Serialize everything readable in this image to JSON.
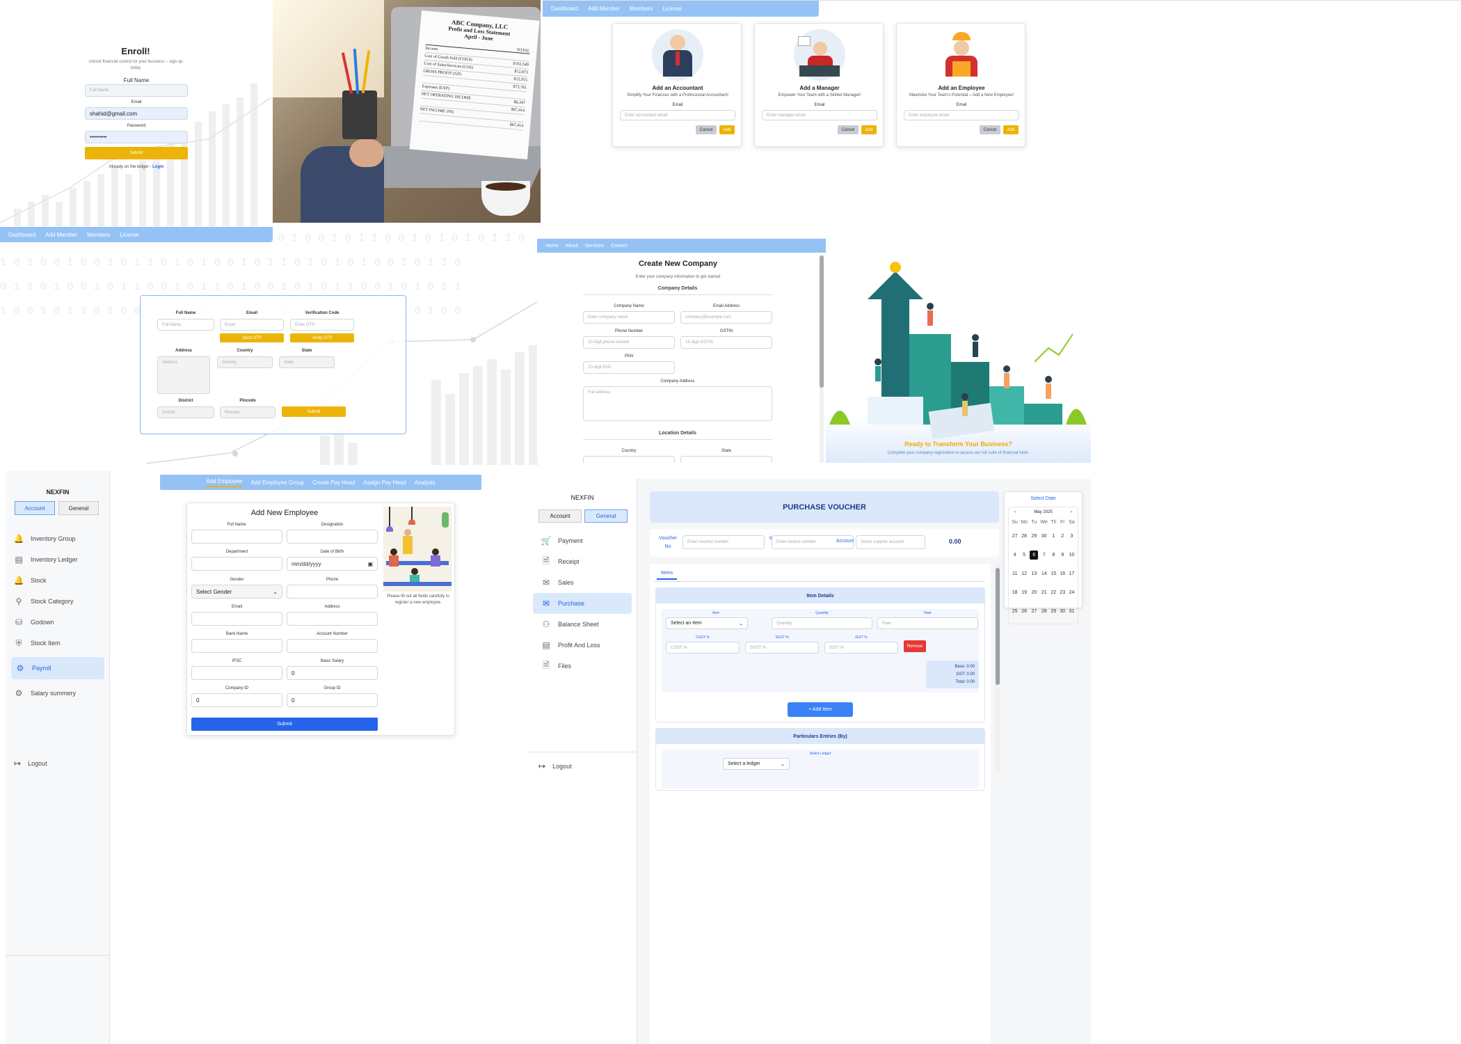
{
  "enroll": {
    "title": "Enroll!",
    "subtitle": "Unlock financial control for your business – sign up today",
    "full_name_label": "Full Name",
    "full_name_placeholder": "Full Name",
    "email_label": "Email",
    "email_value": "shahid@gmail.com",
    "password_label": "Password",
    "password_value": "••••••••••",
    "submit_label": "Submit",
    "footer_text": "Already on the ledger -",
    "login_link": "Login"
  },
  "laptop_doc": {
    "company": "ABC Company, LLC",
    "title": "Profit and Loss Statement",
    "period": "April - June",
    "col_header": "TOTAL",
    "rows": [
      {
        "label": "Income",
        "value": ""
      },
      {
        "label": "Cost of Goods Sold (COGS)",
        "value": "$102,549"
      },
      {
        "label": "Cost of Sales/Services (COS)",
        "value": "$12,873"
      },
      {
        "label": "GROSS PROFIT (GP)",
        "value": "$15,915"
      },
      {
        "label": "",
        "value": "$73,761"
      },
      {
        "label": "Expenses (EXP)",
        "value": ""
      },
      {
        "label": "NET OPERATING INCOME",
        "value": "$6,347"
      },
      {
        "label": "",
        "value": "$67,414"
      },
      {
        "label": "NET INCOME (NI)",
        "value": ""
      },
      {
        "label": "",
        "value": "$67,414"
      }
    ]
  },
  "top_nav": {
    "items": [
      "Dashboard",
      "Add Member",
      "Members",
      "License"
    ]
  },
  "add_cards": [
    {
      "title": "Add an Accountant",
      "subtitle": "Simplify Your Finances with a Professional Accountant!",
      "email_label": "Email",
      "placeholder": "Enter accountant email",
      "cancel": "Cancel",
      "add": "Add"
    },
    {
      "title": "Add a Manager",
      "subtitle": "Empower Your Team with a Skilled Manager!",
      "email_label": "Email",
      "placeholder": "Enter manager email",
      "cancel": "Cancel",
      "add": "Add"
    },
    {
      "title": "Add an Employee",
      "subtitle": "Maximize Your Team's Potential – Add a New Employee!",
      "email_label": "Email",
      "placeholder": "Enter employee email",
      "cancel": "Cancel",
      "add": "Add"
    }
  ],
  "mid_nav": {
    "items": [
      "Dashboard",
      "Add Member",
      "Members",
      "License"
    ]
  },
  "member_form": {
    "full_name_label": "Full Name",
    "full_name_ph": "Full Name",
    "email_label": "Email",
    "email_ph": "Email",
    "verify_label": "Verification Code",
    "verify_ph": "Enter OTP",
    "send_otp": "Send OTP",
    "verify_otp": "Verify OTP",
    "address_label": "Address",
    "address_ph": "Address",
    "country_label": "Country",
    "country_ph": "Country",
    "state_label": "State",
    "state_ph": "State",
    "district_label": "District",
    "district_ph": "District",
    "pincode_label": "Pincode",
    "pincode_ph": "Pincode",
    "submit": "Submit"
  },
  "company_nav": {
    "items": [
      "Home",
      "About",
      "Services",
      "Contact"
    ]
  },
  "company_form": {
    "title": "Create New Company",
    "subtitle": "Enter your company information to get started",
    "section1": "Company Details",
    "company_name_label": "Company Name",
    "company_name_ph": "Enter company name",
    "email_label": "Email Address",
    "email_ph": "company@example.com",
    "phone_label": "Phone Number",
    "phone_ph": "10-digit phone number",
    "gstin_label": "GSTIN",
    "gstin_ph": "15-digit GSTIN",
    "pan_label": "PAN",
    "pan_ph": "10-digit PAN",
    "address_label": "Company Address",
    "address_ph": "Full address",
    "section2": "Location Details",
    "country_label": "Country",
    "state_label": "State"
  },
  "promo": {
    "headline": "Ready to Transform Your Business?",
    "sub": "Complete your company registration to access our full suite of financial tools."
  },
  "left_app": {
    "brand": "NEXFIN",
    "tab_account": "Account",
    "tab_general": "General",
    "items": [
      {
        "label": "Inventory Group",
        "icon": "bell-icon"
      },
      {
        "label": "Inventory Ledger",
        "icon": "book-icon"
      },
      {
        "label": "Stock",
        "icon": "bell-icon"
      },
      {
        "label": "Stock Category",
        "icon": "key-icon"
      },
      {
        "label": "Godown",
        "icon": "database-icon"
      },
      {
        "label": "Stock Item",
        "icon": "shield-icon"
      },
      {
        "label": "Payroll",
        "icon": "gear-icon"
      },
      {
        "label": "Salary summery",
        "icon": "gear-icon"
      }
    ],
    "logout": "Logout"
  },
  "employee_tabs": [
    "Add Employee",
    "Add Employee Group",
    "Create Pay Head",
    "Assign Pay Head",
    "Analysis"
  ],
  "employee_form": {
    "title": "Add New Employee",
    "full_name": "Full Name",
    "designation": "Designation",
    "department": "Department",
    "dob": "Date of Birth",
    "dob_ph": "mm/dd/yyyy",
    "gender": "Gender",
    "gender_value": "Select Gender",
    "phone": "Phone",
    "email": "Email",
    "address": "Address",
    "bank": "Bank Name",
    "account": "Account Number",
    "ifsc": "IFSC",
    "basic_salary": "Basic Salary",
    "basic_salary_value": "0",
    "company_id": "Company ID",
    "company_id_value": "0",
    "group_id": "Group ID",
    "group_id_value": "0",
    "submit": "Submit",
    "note": "Please fill out all fields carefully to register a new employee."
  },
  "right_app": {
    "brand": "NEXFIN",
    "tab_account": "Account",
    "tab_general": "General",
    "items": [
      {
        "label": "Payment",
        "icon": "cart-icon"
      },
      {
        "label": "Receipt",
        "icon": "document-icon"
      },
      {
        "label": "Sales",
        "icon": "mail-icon"
      },
      {
        "label": "Purchase",
        "icon": "mail-icon"
      },
      {
        "label": "Balance Sheet",
        "icon": "users-icon"
      },
      {
        "label": "Profit And Loss",
        "icon": "book-icon"
      },
      {
        "label": "Files",
        "icon": "document-icon"
      }
    ],
    "logout": "Logout"
  },
  "voucher": {
    "title": "PURCHASE VOUCHER",
    "voucher_no_label": "Voucher No",
    "voucher_ph": "Enter voucher number",
    "invoice_label": "Invoice No",
    "invoice_ph": "Enter invoice number",
    "account_label": "Account",
    "account_ph": "Select supplier account",
    "amount": "0.00",
    "tab_items": "Items",
    "item_details": "Item Details",
    "item_label": "Item",
    "item_value": "Select an Item",
    "qty_label": "Quantity",
    "qty_ph": "Quantity",
    "rate_label": "Rate",
    "rate_ph": "Rate",
    "cgst_label": "CGST %",
    "cgst_ph": "CGST %",
    "sgst_label": "SGST %",
    "sgst_ph": "SGST %",
    "igst_label": "IGST %",
    "igst_ph": "IGST %",
    "remove": "Remove",
    "base": "Base: 0.00",
    "gst": "GST: 0.00",
    "total": "Total: 0.00",
    "add_item": "+ Add Item",
    "particulars": "Particulars Entries (By)",
    "ledger_label": "Select Ledger",
    "ledger_value": "Select a ledger"
  },
  "calendar": {
    "title": "Select Date",
    "month": "May 2025",
    "weekdays": [
      "Su",
      "Mo",
      "Tu",
      "We",
      "Th",
      "Fr",
      "Sa"
    ],
    "weeks": [
      [
        "27",
        "28",
        "29",
        "30",
        "1",
        "2",
        "3"
      ],
      [
        "4",
        "5",
        "6",
        "7",
        "8",
        "9",
        "10"
      ],
      [
        "11",
        "12",
        "13",
        "14",
        "15",
        "16",
        "17"
      ],
      [
        "18",
        "19",
        "20",
        "21",
        "22",
        "23",
        "24"
      ],
      [
        "25",
        "26",
        "27",
        "28",
        "29",
        "30",
        "31"
      ]
    ],
    "selected": "6"
  },
  "colors": {
    "accent_yellow": "#ecb408",
    "nav_blue": "#95c2f5",
    "primary_blue": "#3b82f6",
    "remove_red": "#e53935"
  }
}
